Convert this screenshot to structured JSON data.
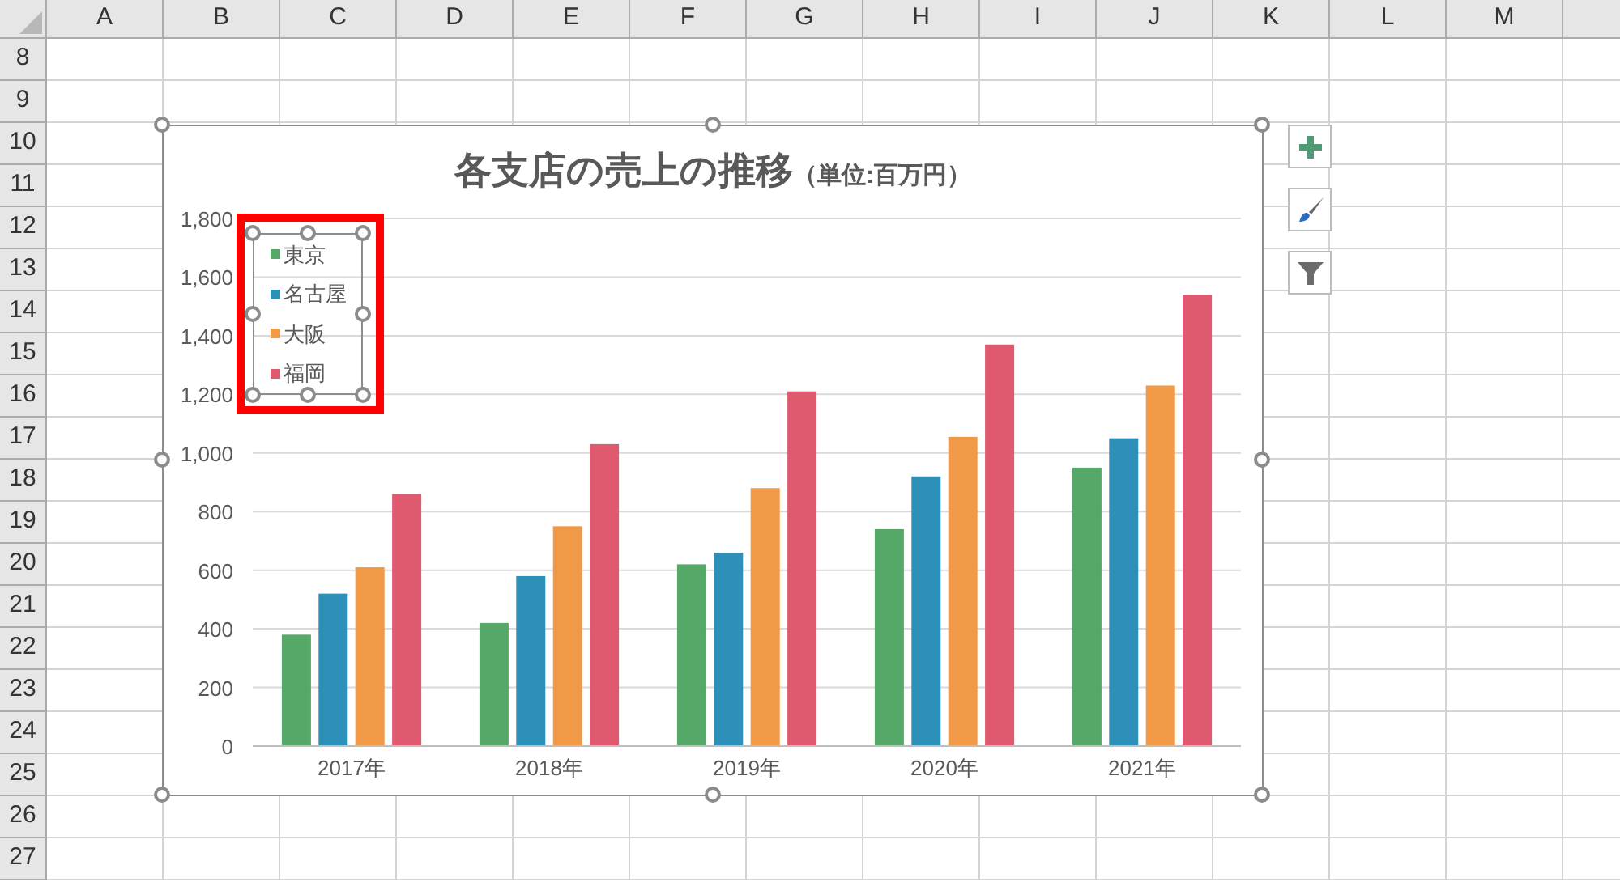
{
  "sheet": {
    "columns": [
      "A",
      "B",
      "C",
      "D",
      "E",
      "F",
      "G",
      "H",
      "I",
      "J",
      "K",
      "L",
      "M"
    ],
    "rows": [
      "8",
      "9",
      "10",
      "11",
      "12",
      "13",
      "14",
      "15",
      "16",
      "17",
      "18",
      "19",
      "20",
      "21",
      "22",
      "23",
      "24",
      "25",
      "26",
      "27"
    ]
  },
  "chart": {
    "title": "各支店の売上の推移",
    "unit": "（単位:百万円）",
    "selected": true,
    "legend": {
      "selected": true
    },
    "chart_data": {
      "type": "bar",
      "grid": true,
      "categories": [
        "2017年",
        "2018年",
        "2019年",
        "2020年",
        "2021年"
      ],
      "ylim": [
        0,
        1800
      ],
      "yticks": [
        {
          "value": 0,
          "label": "0"
        },
        {
          "value": 200,
          "label": "200"
        },
        {
          "value": 400,
          "label": "400"
        },
        {
          "value": 600,
          "label": "600"
        },
        {
          "value": 800,
          "label": "800"
        },
        {
          "value": 1000,
          "label": "1,000"
        },
        {
          "value": 1200,
          "label": "1,200"
        },
        {
          "value": 1400,
          "label": "1,400"
        },
        {
          "value": 1600,
          "label": "1,600"
        },
        {
          "value": 1800,
          "label": "1,800"
        }
      ],
      "series": [
        {
          "name": "東京",
          "color": "#55a868",
          "values": [
            380,
            420,
            620,
            740,
            950
          ]
        },
        {
          "name": "名古屋",
          "color": "#2e8fb8",
          "values": [
            520,
            580,
            660,
            920,
            1050
          ]
        },
        {
          "name": "大阪",
          "color": "#f09a48",
          "values": [
            610,
            750,
            880,
            1055,
            1230
          ]
        },
        {
          "name": "福岡",
          "color": "#df5a6e",
          "values": [
            860,
            1030,
            1210,
            1370,
            1540
          ]
        }
      ]
    }
  }
}
